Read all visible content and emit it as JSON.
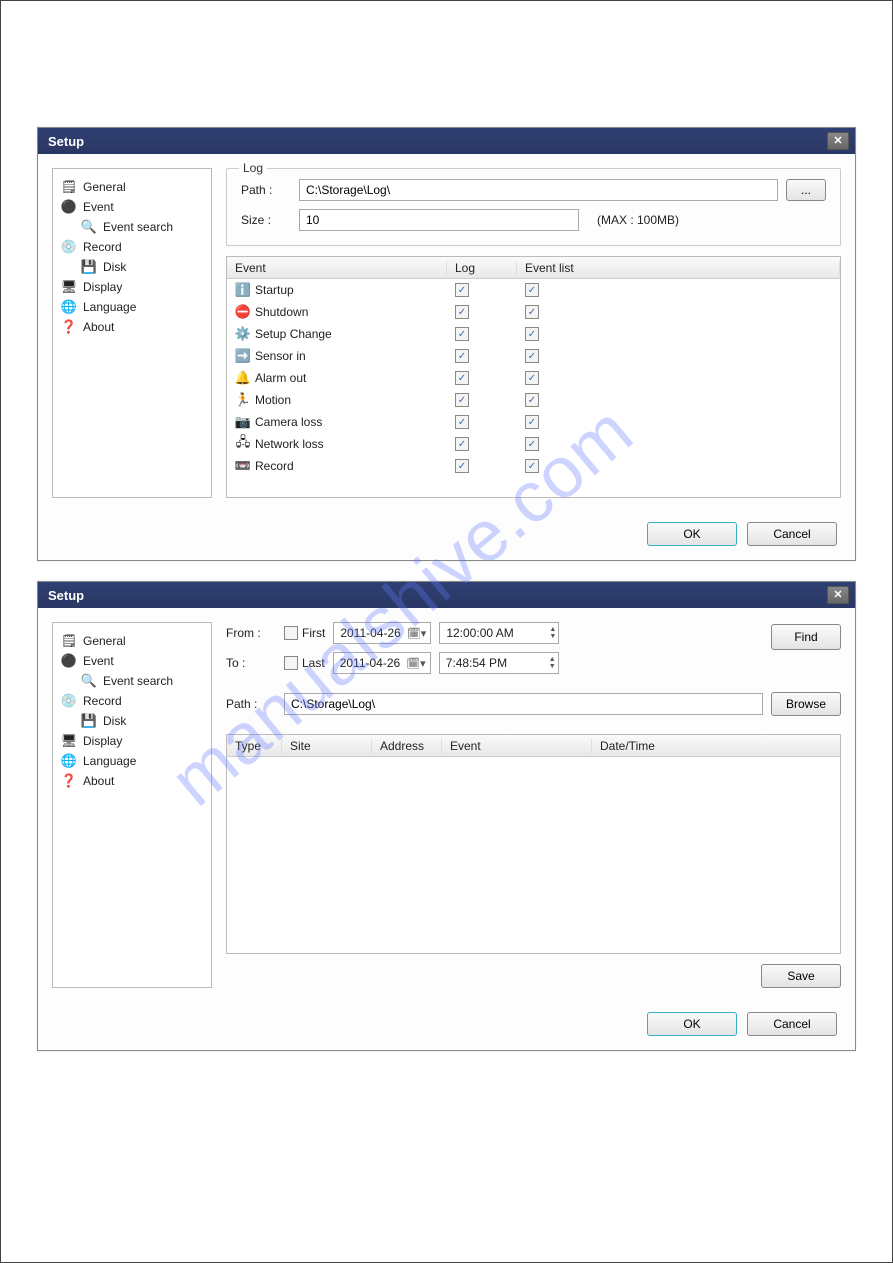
{
  "watermark": "manualshive.com",
  "win1": {
    "title": "Setup",
    "nav": [
      {
        "label": "General",
        "icon": "🗒",
        "child": false
      },
      {
        "label": "Event",
        "icon": "⚫",
        "child": false
      },
      {
        "label": "Event search",
        "icon": "🔍",
        "child": true
      },
      {
        "label": "Record",
        "icon": "💿",
        "child": false
      },
      {
        "label": "Disk",
        "icon": "💾",
        "child": true
      },
      {
        "label": "Display",
        "icon": "🖥",
        "child": false
      },
      {
        "label": "Language",
        "icon": "🌐",
        "child": false
      },
      {
        "label": "About",
        "icon": "❓",
        "child": false
      }
    ],
    "log": {
      "legend": "Log",
      "path_label": "Path :",
      "path_value": "C:\\Storage\\Log\\",
      "browse_label": "...",
      "size_label": "Size :",
      "size_value": "10",
      "size_note": "(MAX : 100MB)"
    },
    "event_table": {
      "cols": {
        "event": "Event",
        "log": "Log",
        "evlist": "Event list"
      },
      "rows": [
        {
          "icon": "ℹ️",
          "name": "Startup",
          "log": true,
          "list": true
        },
        {
          "icon": "⛔",
          "name": "Shutdown",
          "log": true,
          "list": true
        },
        {
          "icon": "⚙️",
          "name": "Setup Change",
          "log": true,
          "list": true
        },
        {
          "icon": "➡️",
          "name": "Sensor in",
          "log": true,
          "list": true
        },
        {
          "icon": "🔔",
          "name": "Alarm out",
          "log": true,
          "list": true
        },
        {
          "icon": "🏃",
          "name": "Motion",
          "log": true,
          "list": true
        },
        {
          "icon": "📷",
          "name": "Camera loss",
          "log": true,
          "list": true
        },
        {
          "icon": "🖧",
          "name": "Network loss",
          "log": true,
          "list": true
        },
        {
          "icon": "📼",
          "name": "Record",
          "log": true,
          "list": true
        }
      ]
    },
    "ok": "OK",
    "cancel": "Cancel"
  },
  "win2": {
    "title": "Setup",
    "from_label": "From :",
    "to_label": "To :",
    "first_label": "First",
    "last_label": "Last",
    "date_from": "2011-04-26",
    "time_from": "12:00:00 AM",
    "date_to": "2011-04-26",
    "time_to": "7:48:54 PM",
    "find": "Find",
    "path_label": "Path  :",
    "path_value": "C:\\Storage\\Log\\",
    "browse": "Browse",
    "cols": {
      "type": "Type",
      "site": "Site",
      "address": "Address",
      "event": "Event",
      "dt": "Date/Time"
    },
    "save": "Save",
    "ok": "OK",
    "cancel": "Cancel"
  }
}
